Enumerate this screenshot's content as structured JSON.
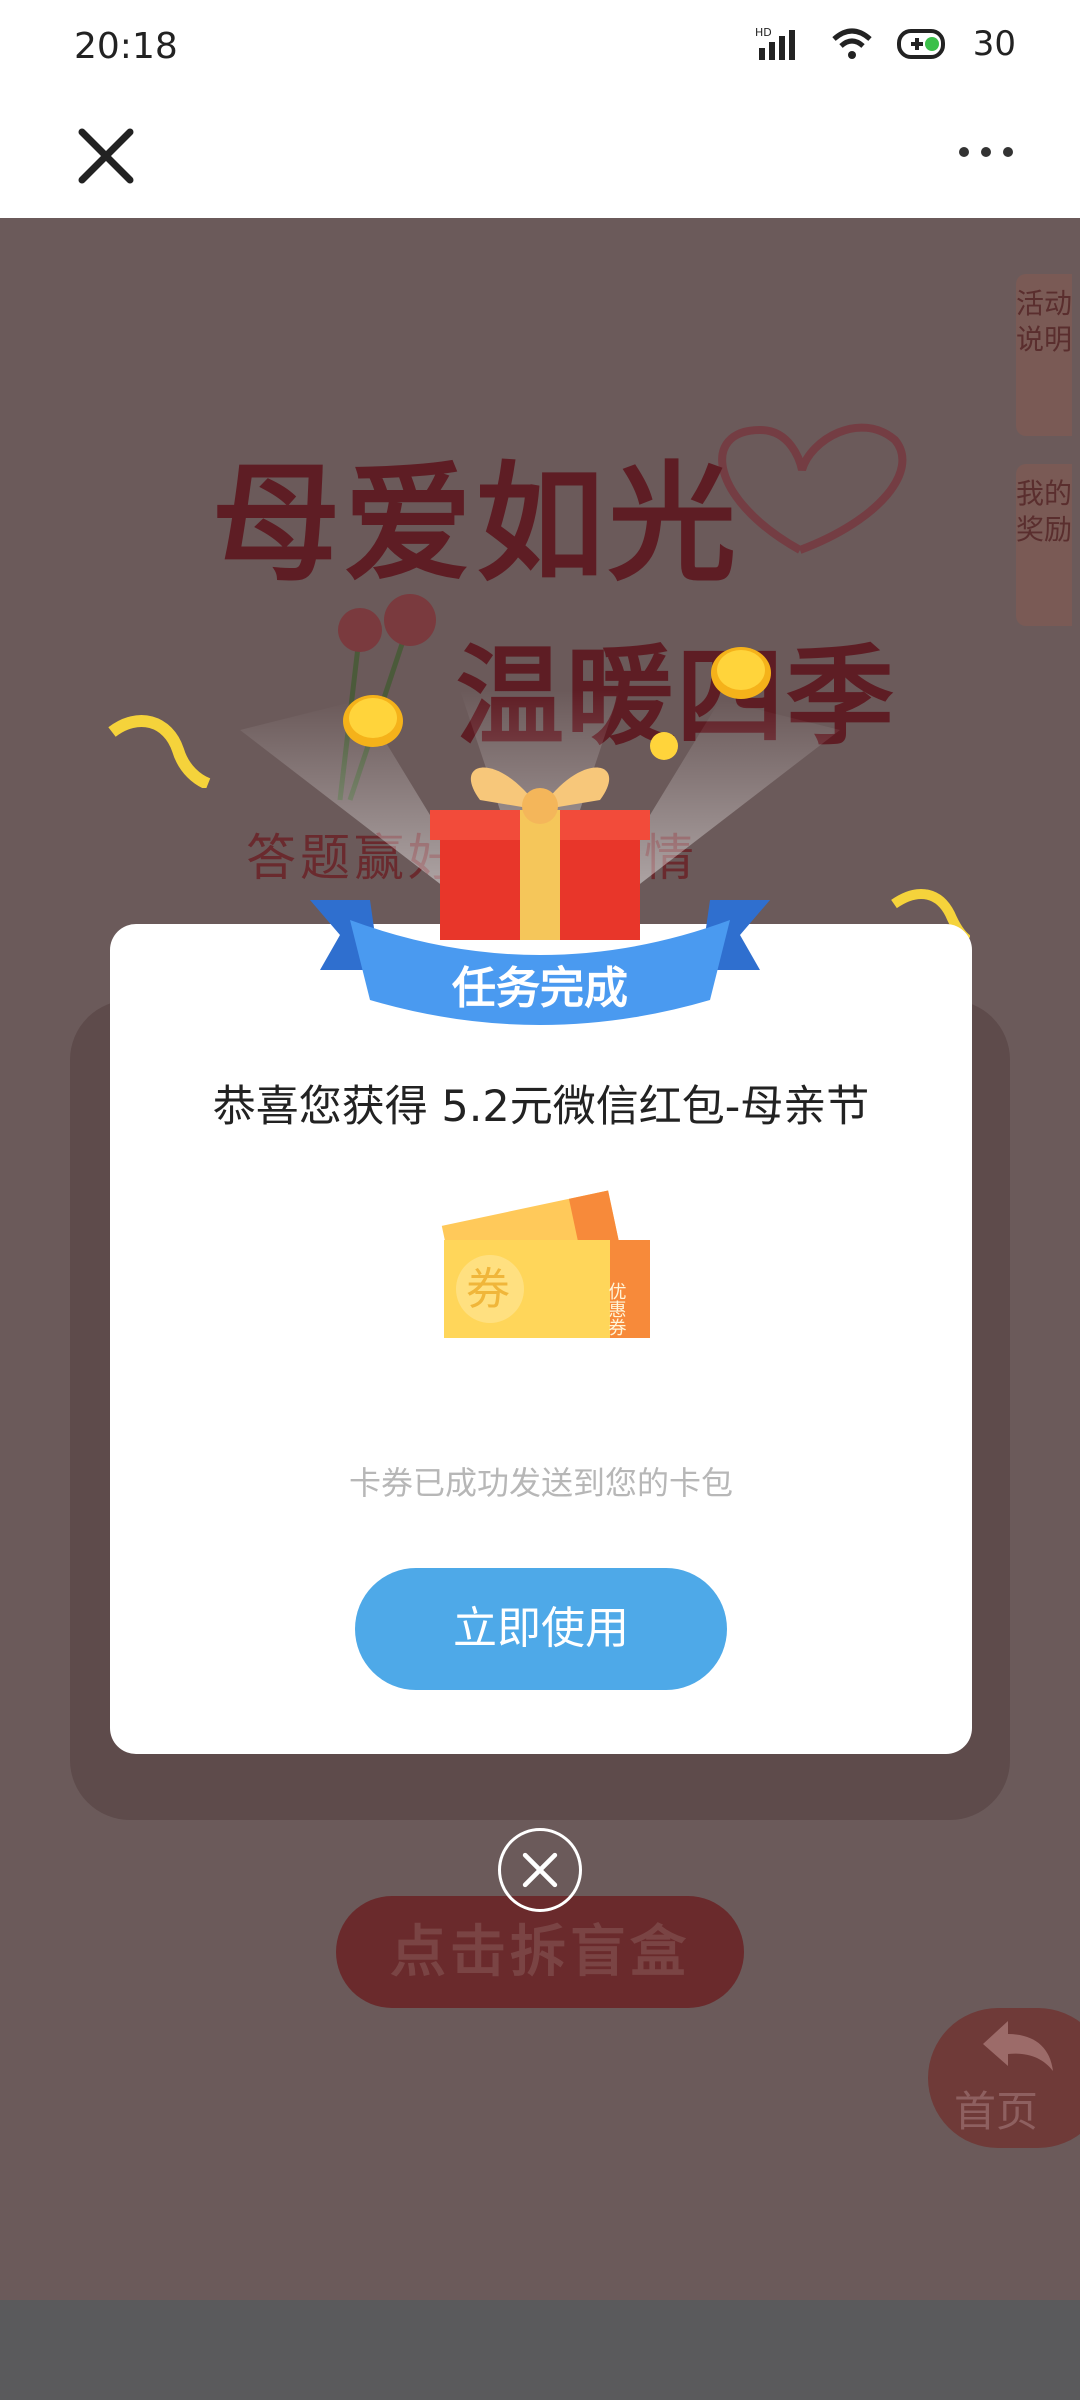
{
  "status_bar": {
    "time": "20:18",
    "battery": "30",
    "network_label": "HD"
  },
  "title_bar": {
    "close_icon": "close-icon",
    "more_icon": "more-dots-icon"
  },
  "background_page": {
    "side_tabs": [
      "活动说明",
      "我的奖励"
    ],
    "hero_line_1": "母爱如光",
    "hero_line_2": "温暖四季",
    "subtitle": "答题赢好礼 传深情",
    "blind_box_button": "点击拆盲盒",
    "home_button": "首页"
  },
  "modal": {
    "banner_title": "任务完成",
    "message": "恭喜您获得 5.2元微信红包-母亲节",
    "ticket_front_label": "券",
    "ticket_side_label": "优惠券",
    "hint": "卡券已成功发送到您的卡包",
    "use_button": "立即使用"
  },
  "colors": {
    "accent_button": "#4ea9e8",
    "banner_blue": "#3f8ee8",
    "dim_overlay": "#6b5a5a",
    "ticket_yellow": "#ffd65a",
    "ticket_orange": "#f78a3a"
  }
}
